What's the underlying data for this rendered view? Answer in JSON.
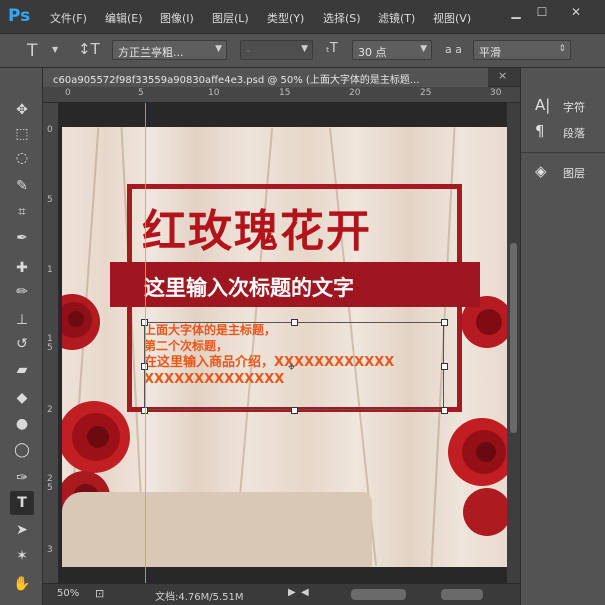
{
  "app": {
    "logo": "Ps"
  },
  "menu": [
    "文件(F)",
    "编辑(E)",
    "图像(I)",
    "图层(L)",
    "类型(Y)",
    "选择(S)",
    "滤镜(T)",
    "视图(V)"
  ],
  "window_controls": {
    "minimize": "▁",
    "restore": "☐",
    "close": "✕"
  },
  "options": {
    "font_family": "方正兰亭粗...",
    "font_style": "-",
    "font_size": "30 点",
    "aa_label": "a a",
    "anti_alias": "平滑"
  },
  "document_tab": {
    "title": "c60a905572f98f33559a90830affe4e3.psd @ 50% (上面大字体的是主标题...",
    "close": "×"
  },
  "rulers": {
    "top": [
      "0",
      "5",
      "10",
      "15",
      "20",
      "25",
      "30"
    ],
    "left": [
      "0",
      "5",
      "1",
      "1 5",
      "2",
      "2 5",
      "3"
    ]
  },
  "artwork": {
    "title": "红玫瑰花开",
    "subtitle": "这里输入次标题的文字",
    "body_lines": [
      "上面大字体的是主标题，",
      "第二个次标题，",
      "在这里输入商品介绍，XXXXXXXXXXXX",
      "XXXXXXXXXXXXXX"
    ]
  },
  "status": {
    "zoom": "50%",
    "doc_info": "文档:4.76M/5.51M"
  },
  "right_panel": [
    {
      "icon": "character-icon",
      "label": "字符"
    },
    {
      "icon": "paragraph-icon",
      "label": "段落"
    },
    {
      "icon": "layers-icon",
      "label": "图层"
    }
  ]
}
